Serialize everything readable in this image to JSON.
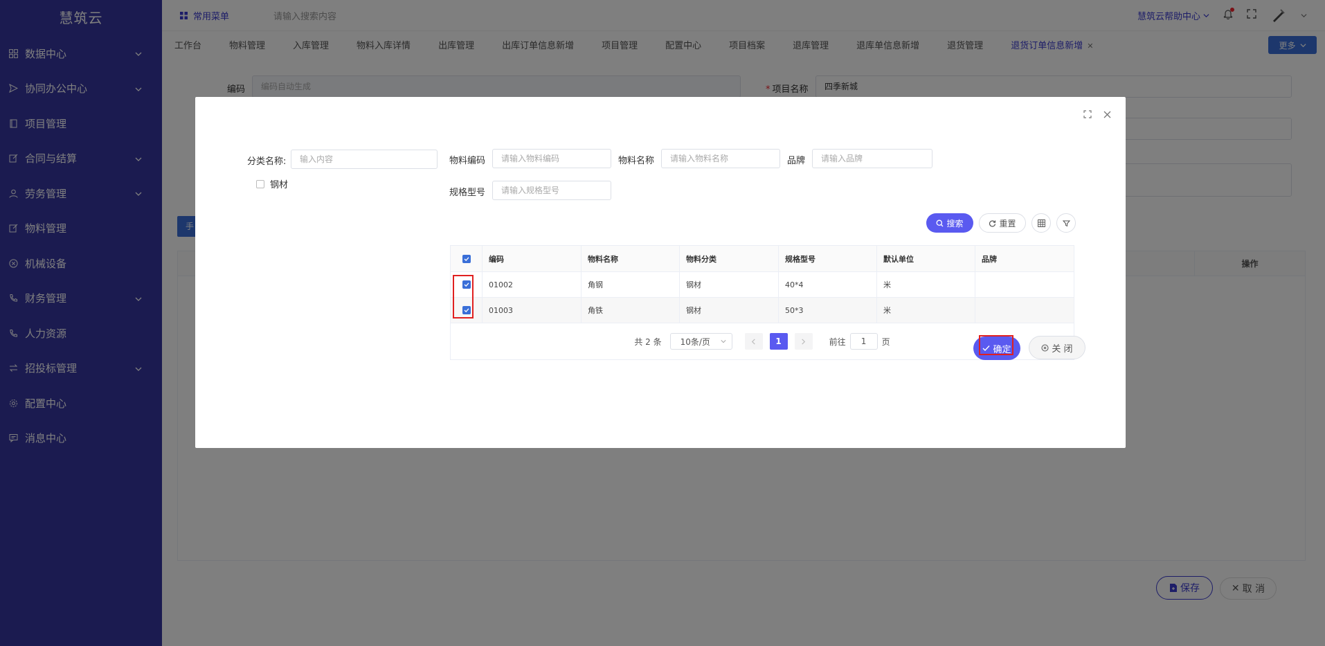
{
  "sidebar": {
    "logo": "慧筑云",
    "items": [
      {
        "label": "数据中心",
        "icon": "grid-icon",
        "expandable": true
      },
      {
        "label": "协同办公中心",
        "icon": "send-icon",
        "expandable": true
      },
      {
        "label": "项目管理",
        "icon": "book-icon",
        "expandable": false
      },
      {
        "label": "合同与结算",
        "icon": "edit-icon",
        "expandable": true
      },
      {
        "label": "劳务管理",
        "icon": "user-icon",
        "expandable": true
      },
      {
        "label": "物料管理",
        "icon": "edit-icon",
        "expandable": false
      },
      {
        "label": "机械设备",
        "icon": "circle-x-icon",
        "expandable": false
      },
      {
        "label": "财务管理",
        "icon": "phone-icon",
        "expandable": true
      },
      {
        "label": "人力资源",
        "icon": "phone-icon",
        "expandable": false
      },
      {
        "label": "招投标管理",
        "icon": "swap-icon",
        "expandable": true
      },
      {
        "label": "配置中心",
        "icon": "gear-icon",
        "expandable": false
      },
      {
        "label": "消息中心",
        "icon": "message-icon",
        "expandable": false
      }
    ]
  },
  "topbar": {
    "menu_label": "常用菜单",
    "search_placeholder": "请输入搜索内容",
    "help_label": "慧筑云帮助中心"
  },
  "tabs": {
    "items": [
      "工作台",
      "物料管理",
      "入库管理",
      "物料入库详情",
      "出库管理",
      "出库订单信息新增",
      "项目管理",
      "配置中心",
      "项目档案",
      "退库管理",
      "退库单信息新增",
      "退货管理"
    ],
    "active": "退货订单信息新增",
    "more_label": "更多"
  },
  "form": {
    "code_label": "编码",
    "code_placeholder": "编码自动生成",
    "project_label": "项目名称",
    "project_value": "四季新城",
    "add_tag": "手",
    "op_header": "操作",
    "save_label": "保存",
    "cancel_label": "取 消"
  },
  "dialog": {
    "category_label": "分类名称:",
    "category_placeholder": "输入内容",
    "tree_node": "钢材",
    "filters": {
      "code_label": "物料编码",
      "code_placeholder": "请输入物料编码",
      "name_label": "物料名称",
      "name_placeholder": "请输入物料名称",
      "brand_label": "品牌",
      "brand_placeholder": "请输入品牌",
      "spec_label": "规格型号",
      "spec_placeholder": "请输入规格型号"
    },
    "search_label": "搜索",
    "reset_label": "重置",
    "table": {
      "headers": [
        "编码",
        "物料名称",
        "物料分类",
        "规格型号",
        "默认单位",
        "品牌"
      ],
      "rows": [
        {
          "code": "01002",
          "name": "角钢",
          "category": "钢材",
          "spec": "40*4",
          "unit": "米",
          "brand": "",
          "checked": true
        },
        {
          "code": "01003",
          "name": "角铁",
          "category": "钢材",
          "spec": "50*3",
          "unit": "米",
          "brand": "",
          "checked": true
        }
      ]
    },
    "pagination": {
      "total": "共 2 条",
      "page_size": "10条/页",
      "current_page": "1",
      "goto_label": "前往",
      "goto_value": "1",
      "page_suffix": "页"
    },
    "ok_label": "确定",
    "close_label": "关 闭"
  },
  "colors": {
    "sidebar_bg": "#3636a0",
    "accent": "#5a5af0",
    "highlight_border": "#e02020"
  }
}
